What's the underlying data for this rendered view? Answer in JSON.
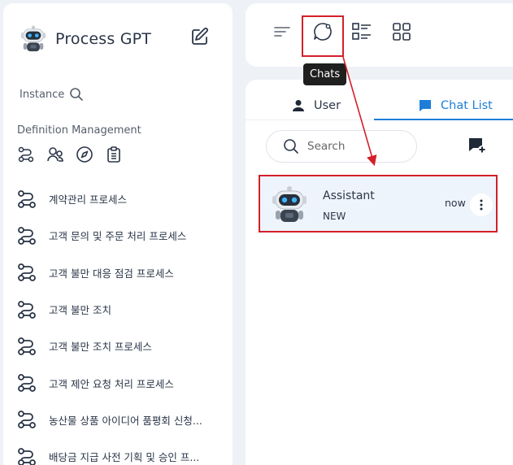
{
  "sidebar": {
    "brand_title": "Process GPT",
    "instance_label": "Instance",
    "definition_label": "Definition Management",
    "processes": [
      "계약관리 프로세스",
      "고객 문의 및 주문 처리 프로세스",
      "고객 불만 대응 점검 프로세스",
      "고객 불만 조치",
      "고객 불만 조치 프로세스",
      "고객 제안 요청 처리 프로세스",
      "농산물 상품 아이디어 품평회 신청...",
      "배당금 지급 사전 기획 및 승인 프..."
    ]
  },
  "toolbar": {
    "tooltip": "Chats",
    "icons": [
      "menu-icon",
      "chat-icon",
      "list-icon",
      "grid-icon"
    ]
  },
  "panel": {
    "tabs": [
      {
        "label": "User",
        "icon": "user-icon",
        "active": false
      },
      {
        "label": "Chat List",
        "icon": "chat-bubble-icon",
        "active": true
      }
    ],
    "search_placeholder": "Search",
    "chat": {
      "name": "Assistant",
      "badge": "NEW",
      "time": "now"
    }
  },
  "colors": {
    "accent": "#1e7dd8",
    "highlight": "#d32029",
    "background": "#eef1f6"
  }
}
